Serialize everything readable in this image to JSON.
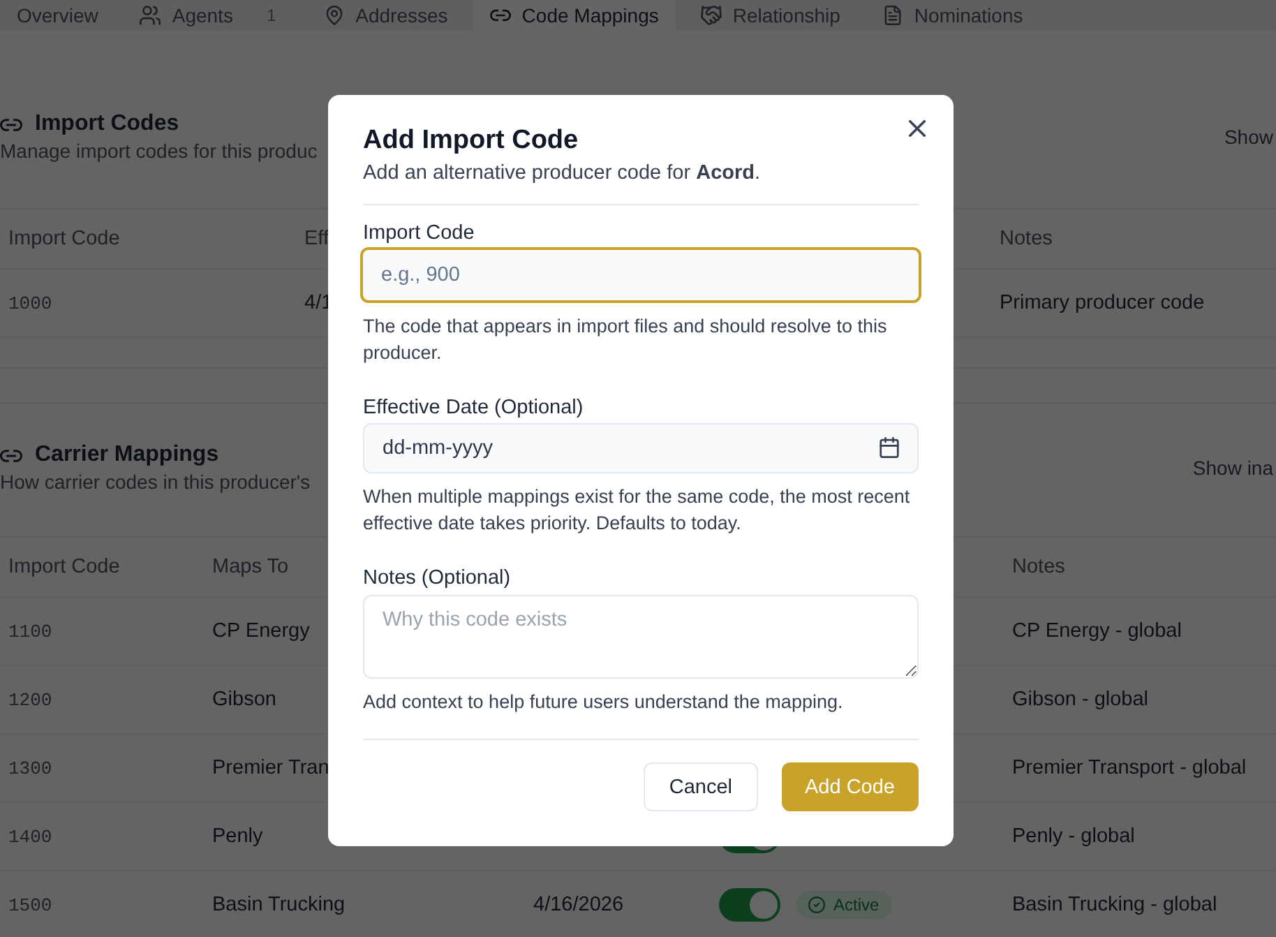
{
  "tabs": [
    {
      "label": "Overview",
      "selected": false
    },
    {
      "label": "Agents",
      "badge": "1",
      "selected": false
    },
    {
      "label": "Addresses",
      "selected": false
    },
    {
      "label": "Code Mappings",
      "selected": true
    },
    {
      "label": "Relationship",
      "selected": false
    },
    {
      "label": "Nominations",
      "selected": false
    }
  ],
  "sections": [
    {
      "title": "Import Codes",
      "subtitle": "Manage import codes for this produc",
      "filter_label": "Show",
      "table": {
        "columns": [
          "Import Code",
          "Eff",
          "Notes"
        ],
        "rows": [
          {
            "import_code": "1000",
            "effective_date": "4/1",
            "notes": "Primary producer code"
          }
        ]
      }
    },
    {
      "title": "Carrier Mappings",
      "subtitle": "How carrier codes in this producer's",
      "filter_label": "Show ina",
      "table": {
        "columns": [
          "Import Code",
          "Maps To",
          "Notes"
        ],
        "rows": [
          {
            "import_code": "1100",
            "maps_to": "CP Energy",
            "notes": "CP Energy - global"
          },
          {
            "import_code": "1200",
            "maps_to": "Gibson",
            "notes": "Gibson - global"
          },
          {
            "import_code": "1300",
            "maps_to": "Premier Tran",
            "notes": "Premier Transport - global"
          },
          {
            "import_code": "1400",
            "maps_to": "Penly",
            "enabled": true,
            "notes": "Penly - global"
          },
          {
            "import_code": "1500",
            "maps_to": "Basin Trucking",
            "effective_date": "4/16/2026",
            "enabled": true,
            "status": "Active",
            "notes": "Basin Trucking - global"
          }
        ]
      }
    }
  ],
  "dialog": {
    "title": "Add Import Code",
    "subtitle": "Add an alternative producer code for **Acord**.",
    "fields": [
      {
        "kind": "text",
        "label": "Import Code",
        "placeholder": "e.g., 900",
        "focused": true,
        "help": "The code that appears in import files and should resolve to this producer."
      },
      {
        "kind": "date",
        "label": "Effective Date (Optional)",
        "placeholder": "dd-mm-yyyy",
        "focused": false,
        "help": "When multiple mappings exist for the same code, the most recent effective date takes priority. Defaults to today."
      },
      {
        "kind": "textarea",
        "label": "Notes (Optional)",
        "placeholder": "Why this code exists",
        "focused": false,
        "help": "Add context to help future users understand the mapping."
      }
    ],
    "buttons": [
      {
        "label": "Cancel",
        "kind": "secondary"
      },
      {
        "label": "Add Code",
        "kind": "primary"
      }
    ]
  }
}
